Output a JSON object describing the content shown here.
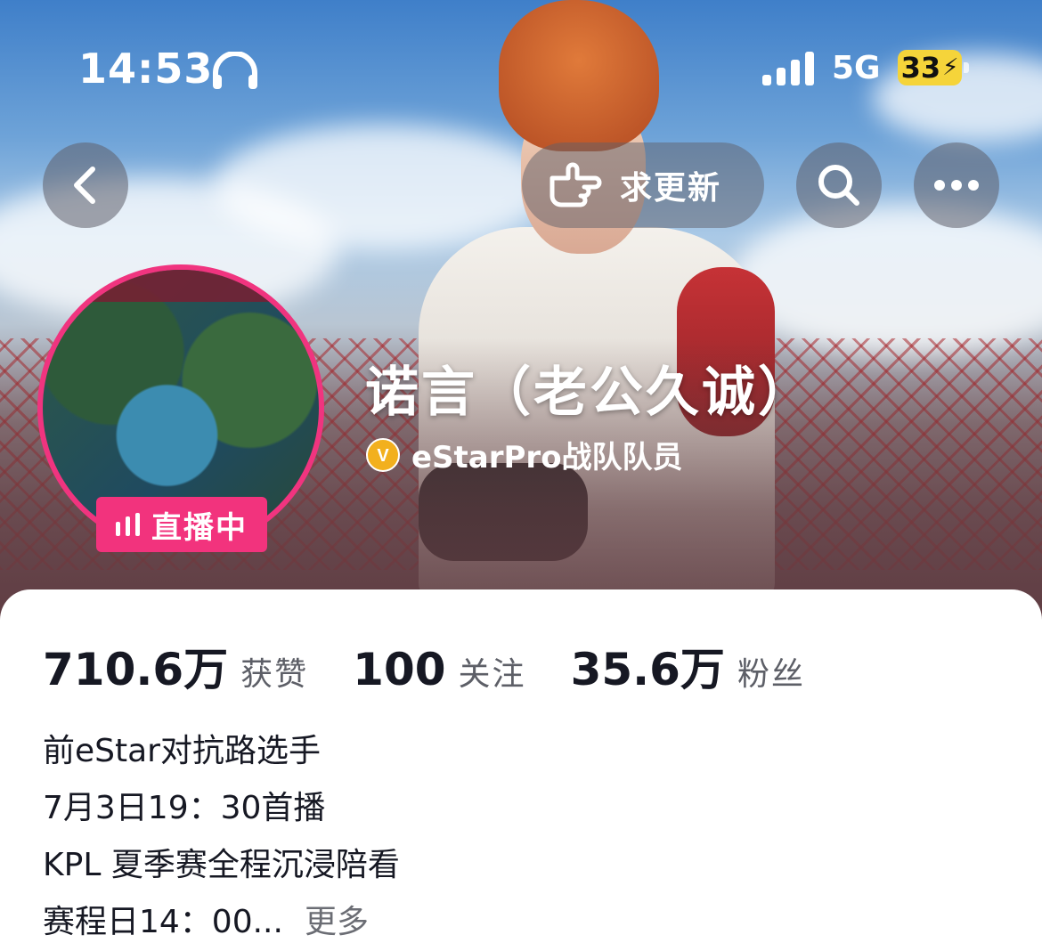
{
  "status_bar": {
    "time": "14:53",
    "network": "5G",
    "battery": "33"
  },
  "header": {
    "update_label": "求更新"
  },
  "profile": {
    "name": "诺言（老公久诚）",
    "verify_icon_letter": "V",
    "verification": "eStarPro战队队员",
    "live_label": "直播中"
  },
  "stats": [
    {
      "value": "710.6万",
      "label": "获赞"
    },
    {
      "value": "100",
      "label": "关注"
    },
    {
      "value": "35.6万",
      "label": "粉丝"
    }
  ],
  "bio": {
    "lines": [
      "前eStar对抗路选手",
      "7月3日19：30首播",
      "KPL 夏季赛全程沉浸陪看",
      "赛程日14：00..."
    ],
    "more_label": "更多"
  },
  "colors": {
    "live_pink": "#f2337d",
    "verify_gold": "#f2b01e",
    "battery_yellow": "#f5d43a"
  }
}
